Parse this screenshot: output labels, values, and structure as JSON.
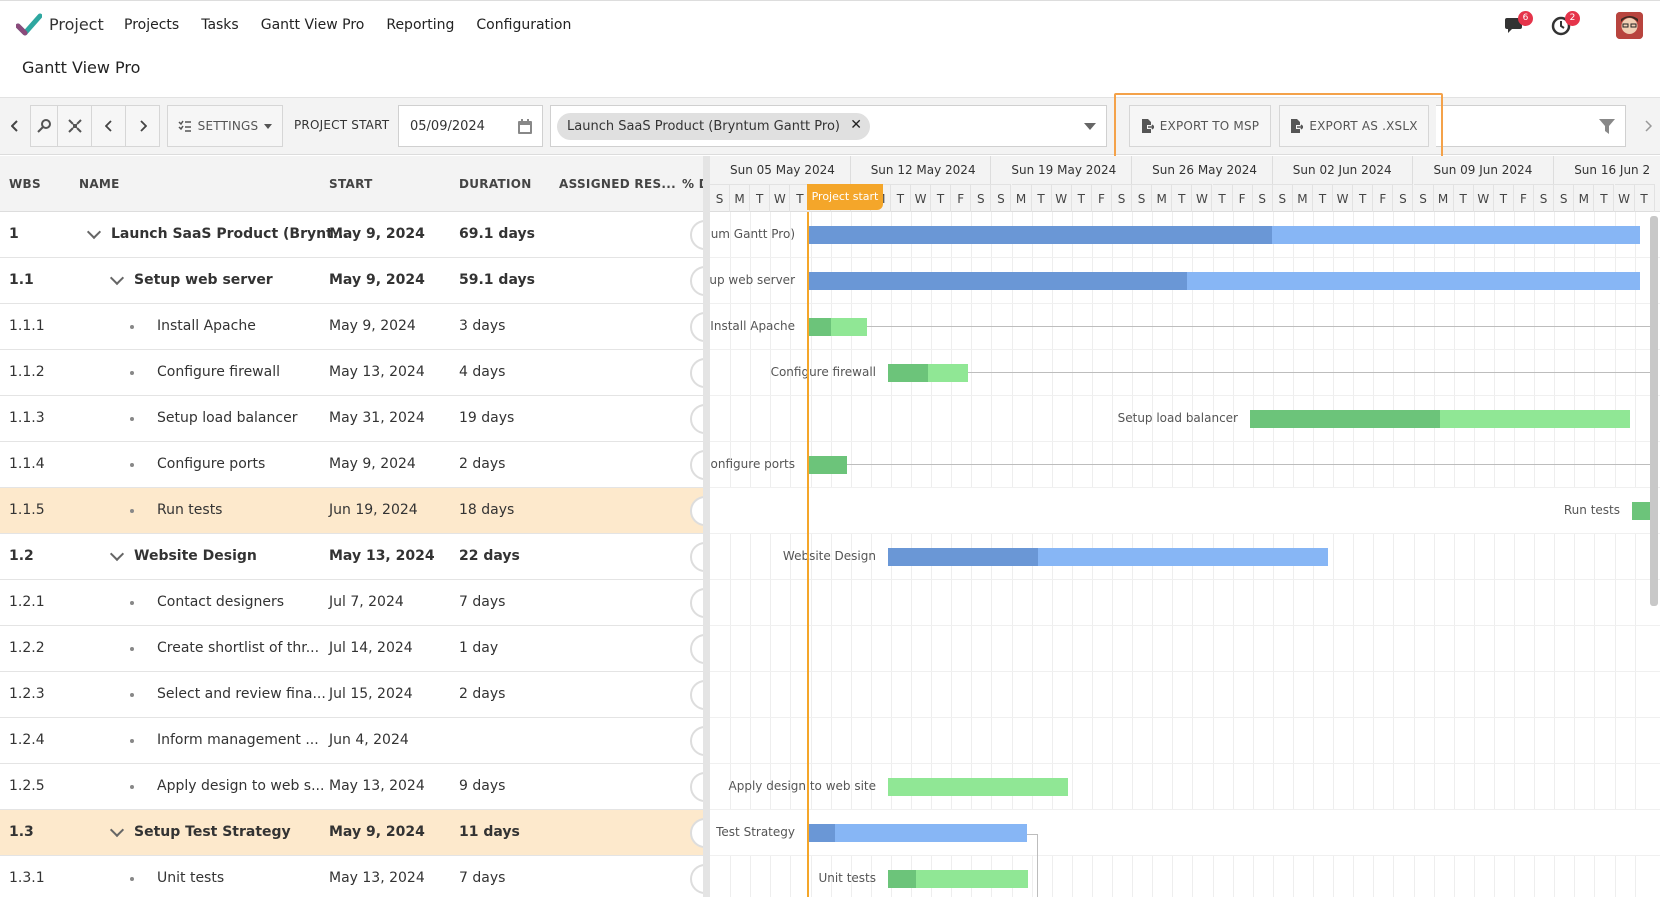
{
  "nav": {
    "app_name": "Project",
    "items": [
      "Projects",
      "Tasks",
      "Gantt View Pro",
      "Reporting",
      "Configuration"
    ],
    "chat_badge": "6",
    "activity_badge": "2"
  },
  "page_title": "Gantt View Pro",
  "toolbar": {
    "settings_label": "SETTINGS",
    "project_start_label": "PROJECT START",
    "project_start_value": "05/09/2024",
    "filter_chip": "Launch SaaS Product (Bryntum Gantt Pro)",
    "export_msp_label": "EXPORT TO MSP",
    "export_xlsx_label": "EXPORT AS .XSLX"
  },
  "grid": {
    "columns": [
      "WBS",
      "NAME",
      "START",
      "DURATION",
      "ASSIGNED RES...",
      "% D"
    ],
    "rows": [
      {
        "wbs": "1",
        "name": "Launch SaaS Product (Brynt...",
        "start": "May 9, 2024",
        "duration": "69.1 days",
        "level": 0,
        "parent": true
      },
      {
        "wbs": "1.1",
        "name": "Setup web server",
        "start": "May 9, 2024",
        "duration": "59.1 days",
        "level": 1,
        "parent": true
      },
      {
        "wbs": "1.1.1",
        "name": "Install Apache",
        "start": "May 9, 2024",
        "duration": "3 days",
        "level": 2,
        "parent": false
      },
      {
        "wbs": "1.1.2",
        "name": "Configure firewall",
        "start": "May 13, 2024",
        "duration": "4 days",
        "level": 2,
        "parent": false
      },
      {
        "wbs": "1.1.3",
        "name": "Setup load balancer",
        "start": "May 31, 2024",
        "duration": "19 days",
        "level": 2,
        "parent": false
      },
      {
        "wbs": "1.1.4",
        "name": "Configure ports",
        "start": "May 9, 2024",
        "duration": "2 days",
        "level": 2,
        "parent": false
      },
      {
        "wbs": "1.1.5",
        "name": "Run tests",
        "start": "Jun 19, 2024",
        "duration": "18 days",
        "level": 2,
        "parent": false,
        "selected": true
      },
      {
        "wbs": "1.2",
        "name": "Website Design",
        "start": "May 13, 2024",
        "duration": "22 days",
        "level": 1,
        "parent": true
      },
      {
        "wbs": "1.2.1",
        "name": "Contact designers",
        "start": "Jul 7, 2024",
        "duration": "7 days",
        "level": 2,
        "parent": false
      },
      {
        "wbs": "1.2.2",
        "name": "Create shortlist of thr...",
        "start": "Jul 14, 2024",
        "duration": "1 day",
        "level": 2,
        "parent": false
      },
      {
        "wbs": "1.2.3",
        "name": "Select and review fina...",
        "start": "Jul 15, 2024",
        "duration": "2 days",
        "level": 2,
        "parent": false
      },
      {
        "wbs": "1.2.4",
        "name": "Inform management ...",
        "start": "Jun 4, 2024",
        "duration": "",
        "level": 2,
        "parent": false
      },
      {
        "wbs": "1.2.5",
        "name": "Apply design to web s...",
        "start": "May 13, 2024",
        "duration": "9 days",
        "level": 2,
        "parent": false
      },
      {
        "wbs": "1.3",
        "name": "Setup Test Strategy",
        "start": "May 9, 2024",
        "duration": "11 days",
        "level": 1,
        "parent": true,
        "selected": true
      },
      {
        "wbs": "1.3.1",
        "name": "Unit tests",
        "start": "May 13, 2024",
        "duration": "7 days",
        "level": 2,
        "parent": false
      }
    ]
  },
  "gantt": {
    "weeks": [
      "Sun 05 May 2024",
      "Sun 12 May 2024",
      "Sun 19 May 2024",
      "Sun 26 May 2024",
      "Sun 02 Jun 2024",
      "Sun 09 Jun 2024",
      "Sun 16 Jun 2"
    ],
    "day_letters": [
      "S",
      "M",
      "T",
      "W",
      "T",
      "F",
      "S"
    ],
    "project_start_tag": "Project start",
    "bar_labels": [
      "um Gantt Pro)",
      "up web server",
      "Install Apache",
      "Configure firewall",
      "Setup load balancer",
      "onfigure ports",
      "Run tests",
      "Website Design",
      "",
      "",
      "",
      "",
      "Apply design to web site",
      "Test Strategy",
      "Unit tests"
    ]
  },
  "colors": {
    "parent_bar_done": "#6a97d6",
    "parent_bar": "#87b6f5",
    "task_bar_done": "#6cc47a",
    "task_bar": "#90e795",
    "accent_orange": "#f4a62a",
    "selected_row": "#fde9cc"
  }
}
